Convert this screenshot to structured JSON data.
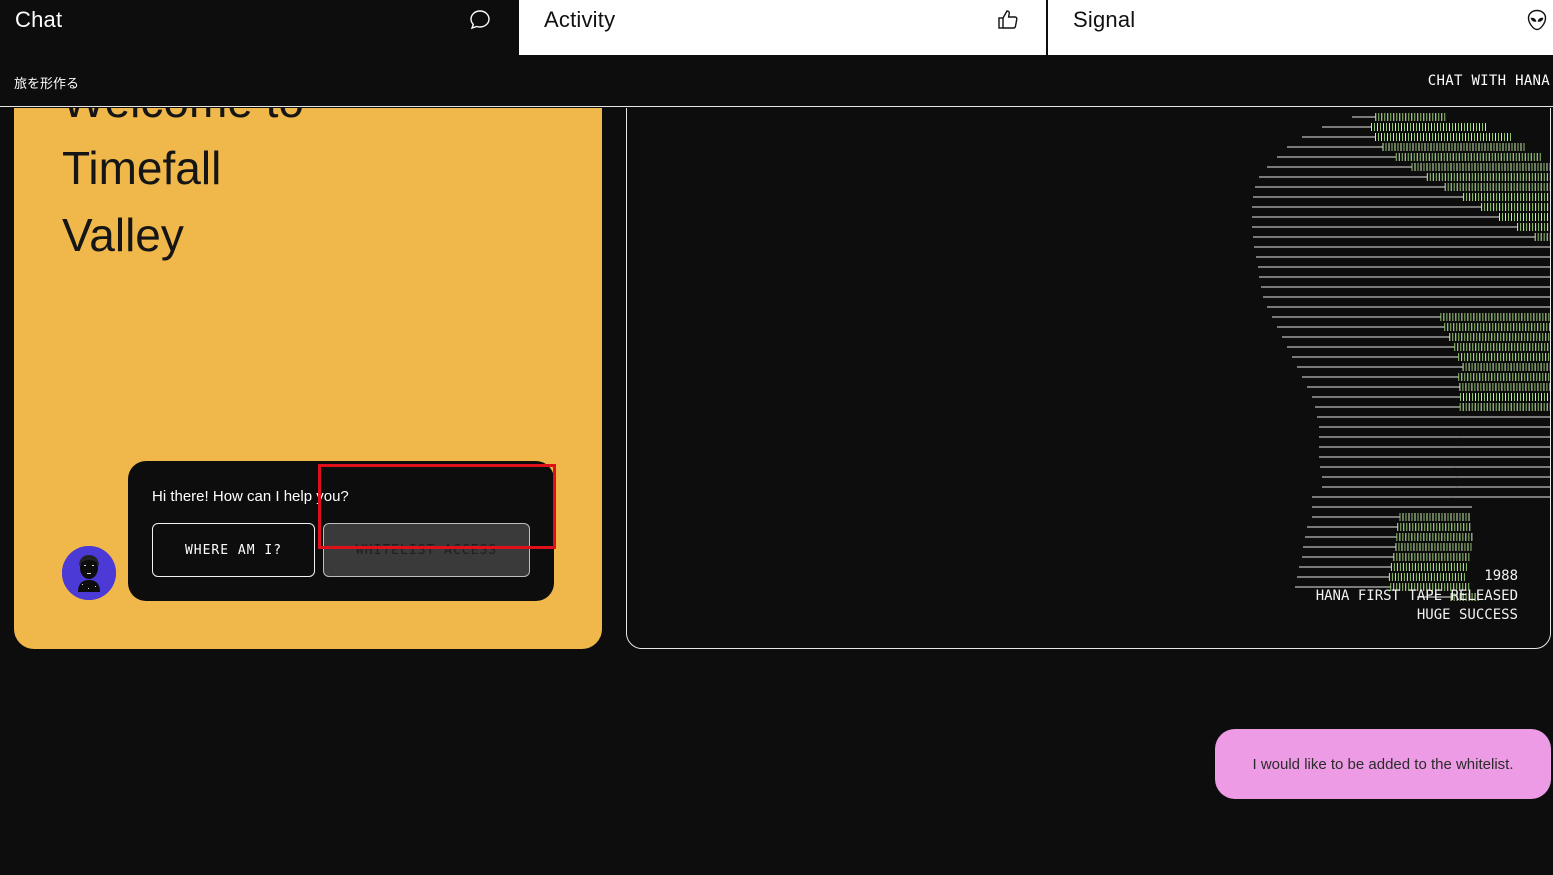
{
  "tabs": {
    "chat": {
      "label": "Chat",
      "icon": "chat-bubble-icon"
    },
    "activity": {
      "label": "Activity",
      "icon": "thumbs-up-icon"
    },
    "signal": {
      "label": "Signal",
      "icon": "alien-icon"
    }
  },
  "header": {
    "tagline": "旅を形作る",
    "cta": "CHAT WITH HANA"
  },
  "hero": {
    "lines": [
      "Welcome to",
      "Timefall",
      "Valley"
    ],
    "background_color": "#f0b84b"
  },
  "assistant": {
    "greeting": "Hi there! How can I help you?",
    "options": [
      {
        "label": "WHERE AM I?"
      },
      {
        "label": "WHITELIST ACCESS"
      }
    ],
    "avatar_icon": "hana-avatar-icon"
  },
  "art": {
    "caption_lines": [
      "1988",
      "HANA FIRST TAPE RELEASED",
      "HUGE SUCCESS"
    ],
    "line_color": "#e8e8e8",
    "accent_color": "#8fc46a"
  },
  "chat": {
    "user_message": "I would like to be added to the whitelist.",
    "bubble_color": "#ee9be5"
  }
}
